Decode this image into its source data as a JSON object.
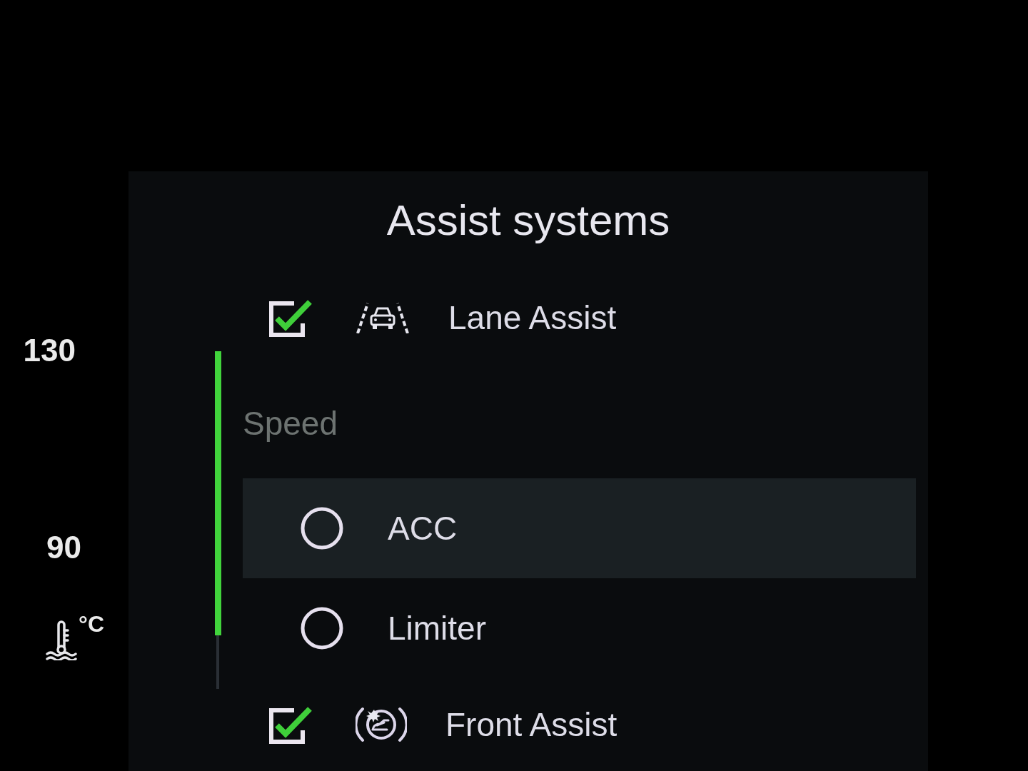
{
  "gauge": {
    "labels": [
      "130",
      "90"
    ],
    "unit": "°C"
  },
  "menu": {
    "title": "Assist systems",
    "items": [
      {
        "kind": "checkbox",
        "label": "Lane Assist",
        "checked": true,
        "selected": false
      },
      {
        "kind": "header",
        "label": "Speed"
      },
      {
        "kind": "radio",
        "label": "ACC",
        "checked": false,
        "selected": true
      },
      {
        "kind": "radio",
        "label": "Limiter",
        "checked": false,
        "selected": false
      },
      {
        "kind": "checkbox",
        "label": "Front Assist",
        "checked": true,
        "selected": false
      }
    ]
  }
}
